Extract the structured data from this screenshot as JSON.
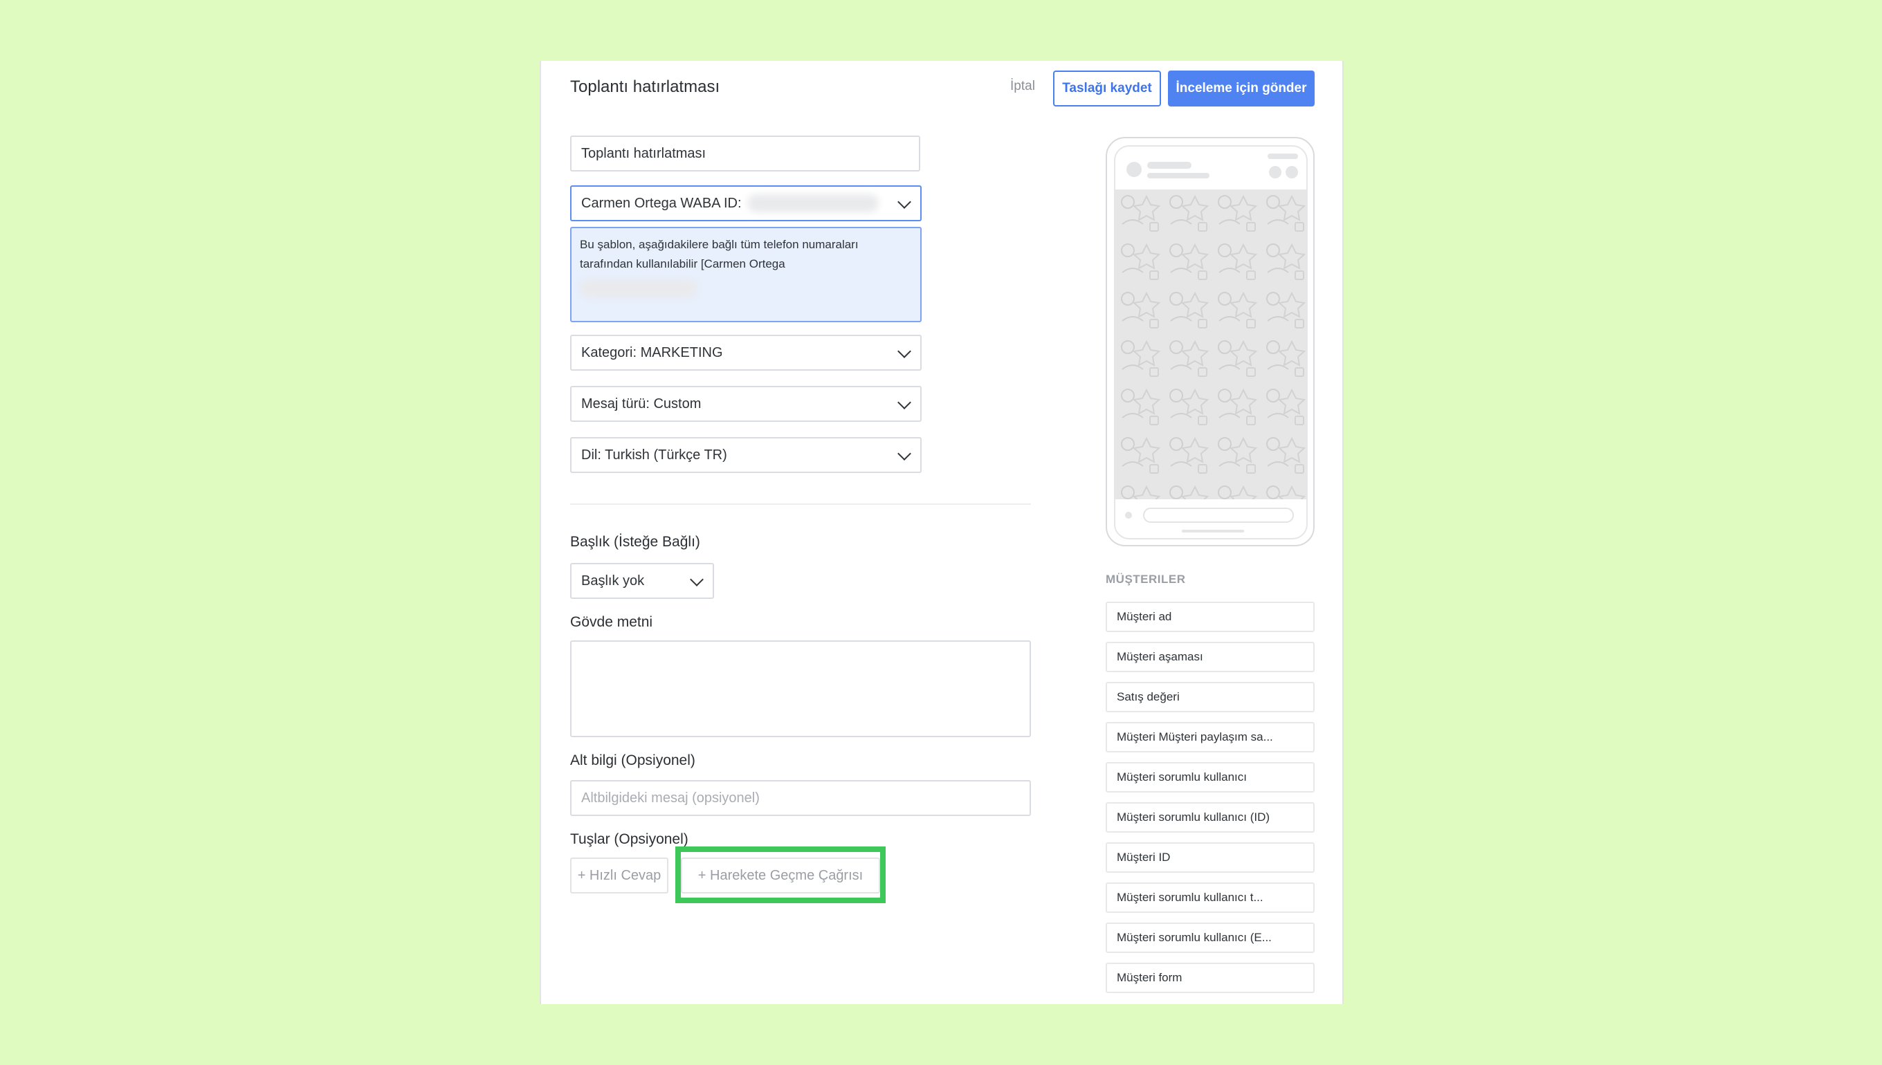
{
  "header": {
    "title": "Toplantı hatırlatması",
    "cancel_label": "İptal",
    "save_draft_label": "Taslağı kaydet",
    "submit_label": "İnceleme için gönder"
  },
  "form": {
    "name_value": "Toplantı hatırlatması",
    "account_select": "Carmen Ortega WABA ID:",
    "info_text_line1": "Bu şablon, aşağıdakilere bağlı tüm telefon numaraları",
    "info_text_line2": "tarafından kullanılabilir [Carmen Ortega",
    "category_select": "Kategori: MARKETING",
    "message_type_select": "Mesaj türü: Custom",
    "language_select": "Dil: Turkish (Türkçe TR)",
    "header_label": "Başlık (İsteğe Bağlı)",
    "header_select": "Başlık yok",
    "body_label": "Gövde metni",
    "footer_label": "Alt bilgi (Opsiyonel)",
    "footer_placeholder": "Altbilgideki mesaj (opsiyonel)",
    "buttons_label": "Tuşlar (Opsiyonel)",
    "quick_reply_label": "+ Hızlı Cevap",
    "cta_label": "+ Harekete Geçme Çağrısı"
  },
  "sidebar": {
    "section_title": "MÜŞTERILER",
    "variables": [
      "Müşteri ad",
      "Müşteri aşaması",
      "Satış değeri",
      "Müşteri Müşteri paylaşım sa...",
      "Müşteri sorumlu kullanıcı",
      "Müşteri sorumlu kullanıcı (ID)",
      "Müşteri ID",
      "Müşteri sorumlu kullanıcı t...",
      "Müşteri sorumlu kullanıcı (E...",
      "Müşteri form"
    ]
  },
  "colors": {
    "background": "#e0fbc0",
    "accent": "#5083f2",
    "highlight": "#3ec85a"
  }
}
